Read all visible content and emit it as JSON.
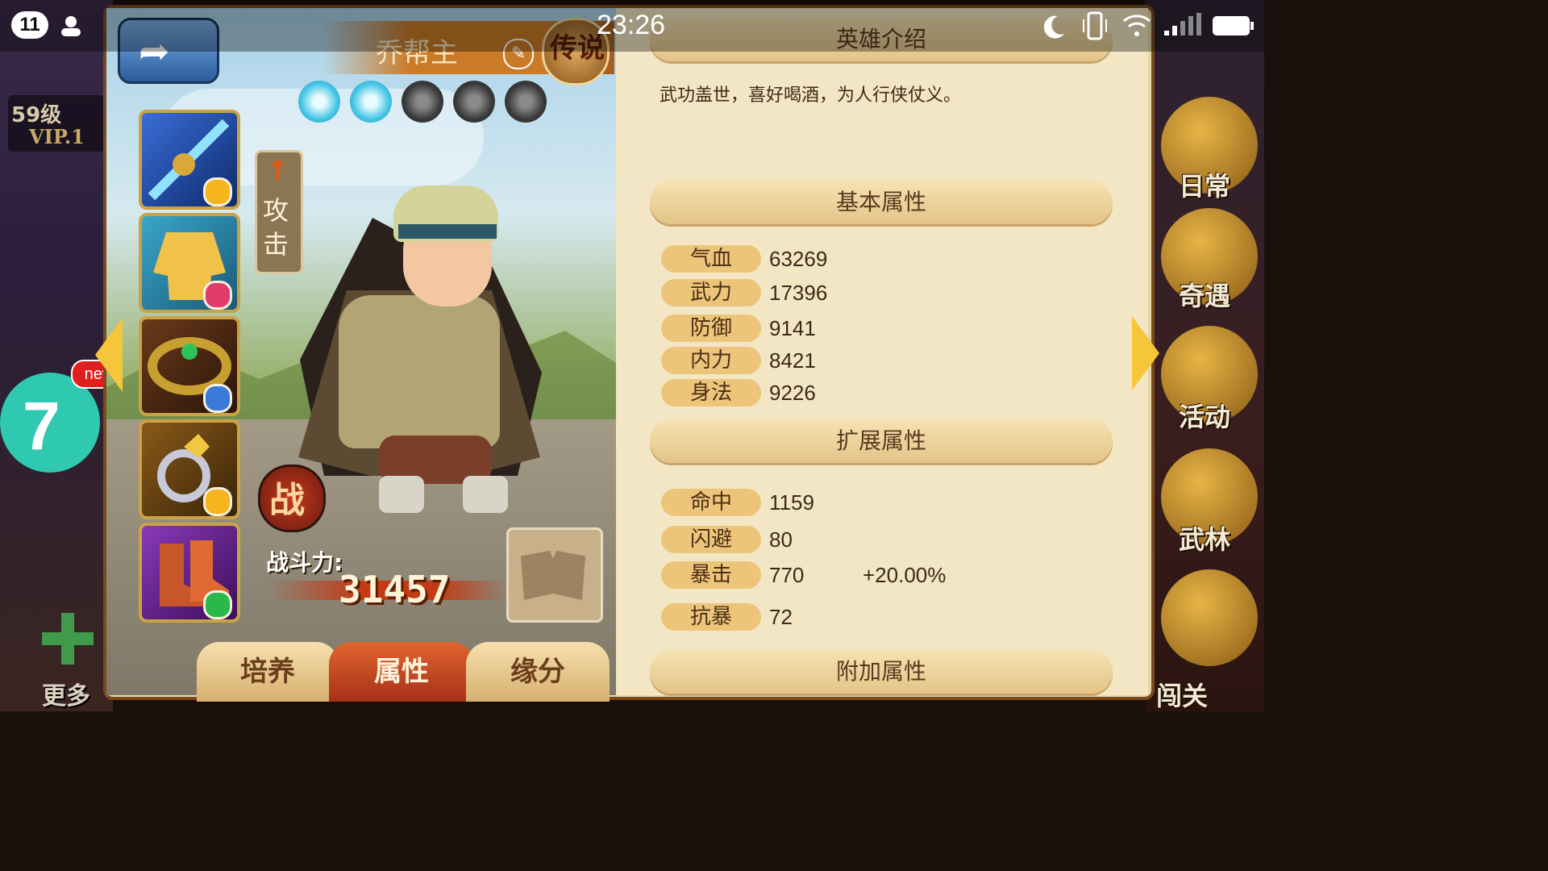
{
  "status_bar": {
    "notification_count": "11",
    "time": "23:26",
    "icons": [
      "contacts-icon",
      "moon-icon",
      "vibrate-icon",
      "wifi-icon",
      "signal-icon",
      "battery-icon"
    ]
  },
  "player": {
    "level": "59级",
    "vip": "VIP.1"
  },
  "left_hud": {
    "new_badge": "new",
    "app_badge": "7",
    "more_label": "更多"
  },
  "right_menu": {
    "items": [
      {
        "label": "日常",
        "icon": "scroll-icon"
      },
      {
        "label": "奇遇",
        "icon": "chest-icon"
      },
      {
        "label": "活动",
        "icon": "gong-icon"
      },
      {
        "label": "武林",
        "icon": "palace-icon"
      },
      {
        "label": "闯关",
        "icon": "gourd-icon"
      }
    ]
  },
  "hero": {
    "name": "乔帮主",
    "rarity_seal": "传说",
    "stars_lit": 2,
    "stars_total": 5,
    "role_tag": "攻击",
    "battle_icon": "战",
    "power_label": "战斗力:",
    "power_value": "31457"
  },
  "equipment": [
    {
      "slot": "weapon",
      "icon": "sword-icon",
      "gem_color": "#f6b51c"
    },
    {
      "slot": "armor",
      "icon": "robe-icon",
      "gem_color": "#e23a6a"
    },
    {
      "slot": "belt",
      "icon": "belt-icon",
      "gem_color": "#3a7ad8"
    },
    {
      "slot": "ring",
      "icon": "ring-icon",
      "gem_color": "#f6b51c"
    },
    {
      "slot": "boots",
      "icon": "boots-icon",
      "gem_color": "#2ab84a"
    }
  ],
  "tabs": [
    {
      "label": "培养",
      "active": false
    },
    {
      "label": "属性",
      "active": true
    },
    {
      "label": "缘分",
      "active": false
    }
  ],
  "info": {
    "intro_title": "英雄介绍",
    "intro_text": "武功盖世，喜好喝酒，为人行侠仗义。",
    "basic_title": "基本属性",
    "basic_stats": [
      {
        "label": "气血",
        "value": "63269"
      },
      {
        "label": "武力",
        "value": "17396"
      },
      {
        "label": "防御",
        "value": "9141"
      },
      {
        "label": "内力",
        "value": "8421"
      },
      {
        "label": "身法",
        "value": "9226"
      }
    ],
    "extended_title": "扩展属性",
    "extended_stats": [
      {
        "label": "命中",
        "value": "1159"
      },
      {
        "label": "闪避",
        "value": "80"
      },
      {
        "label": "暴击",
        "value": "770",
        "bonus": "+20.00%"
      },
      {
        "label": "抗暴",
        "value": "72"
      }
    ],
    "additional_title": "附加属性"
  },
  "colors": {
    "panel_bg": "#f3e6c4",
    "stat_label_bg": "#ecc57a",
    "active_tab": "#c8461e",
    "app_badge": "#2ec9b0"
  }
}
